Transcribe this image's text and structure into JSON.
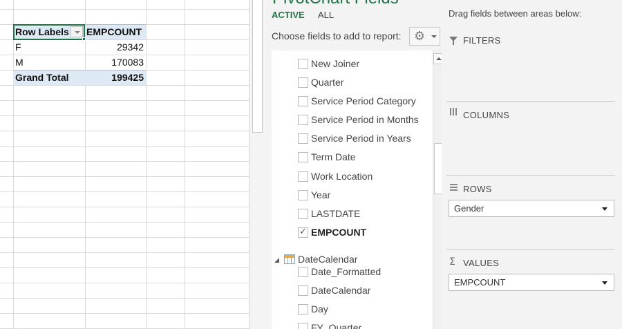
{
  "pivot_table": {
    "header": {
      "row_labels": "Row Labels",
      "value_col": "EMPCOUNT"
    },
    "rows": [
      {
        "label": "F",
        "value": "29342"
      },
      {
        "label": "M",
        "value": "170083"
      }
    ],
    "grand_total": {
      "label": "Grand Total",
      "value": "199425"
    }
  },
  "field_pane": {
    "title": "PivotChart Fields",
    "tabs": [
      {
        "label": "ACTIVE",
        "active": true
      },
      {
        "label": "ALL",
        "active": false
      }
    ],
    "choose_label": "Choose fields to add to report:",
    "fields": [
      {
        "label": "New Joiner",
        "checked": false
      },
      {
        "label": "Quarter",
        "checked": false
      },
      {
        "label": "Service Period Category",
        "checked": false
      },
      {
        "label": "Service Period in Months",
        "checked": false
      },
      {
        "label": "Service Period in Years",
        "checked": false
      },
      {
        "label": "Term Date",
        "checked": false
      },
      {
        "label": "Work Location",
        "checked": false
      },
      {
        "label": "Year",
        "checked": false
      },
      {
        "label": "LASTDATE",
        "checked": false
      },
      {
        "label": "EMPCOUNT",
        "checked": true
      }
    ],
    "table": {
      "label": "DateCalendar",
      "expanded": true
    },
    "table_fields": [
      {
        "label": "Date_Formatted",
        "checked": false
      },
      {
        "label": "DateCalendar",
        "checked": false
      },
      {
        "label": "Day",
        "checked": false
      },
      {
        "label": "FY_Quarter",
        "checked": false
      }
    ]
  },
  "areas": {
    "hint": "Drag fields between areas below:",
    "filters": {
      "label": "FILTERS"
    },
    "columns": {
      "label": "COLUMNS"
    },
    "rows": {
      "label": "ROWS",
      "fields": [
        "Gender"
      ]
    },
    "values": {
      "label": "VALUES",
      "fields": [
        "EMPCOUNT"
      ]
    }
  },
  "colors": {
    "accent": "#217346",
    "pivot_header": "#dde9f5"
  },
  "icons": [
    "filter-dropdown-icon",
    "gear-icon",
    "table-icon",
    "filter-icon",
    "columns-icon",
    "rows-icon",
    "sigma-icon",
    "dropdown-arrow-icon"
  ]
}
